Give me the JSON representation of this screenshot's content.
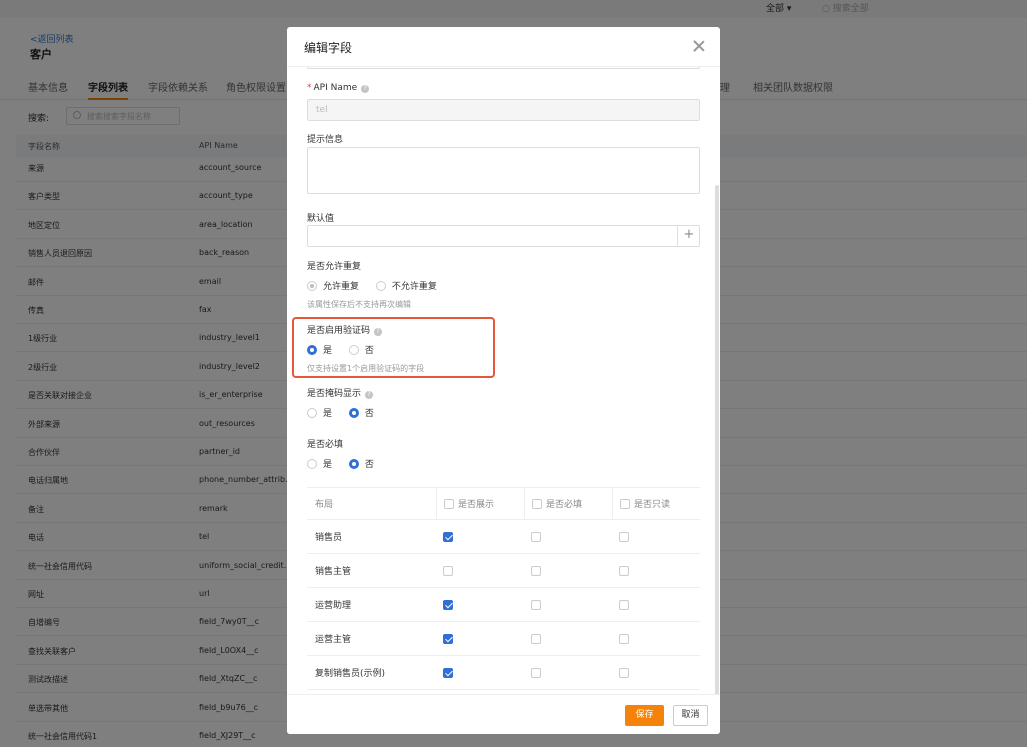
{
  "topbar": {
    "filter_label": "全部 ▾",
    "search_placeholder": "搜索全部"
  },
  "header": {
    "back_link": "<返回列表",
    "title": "客户"
  },
  "tabs": [
    {
      "label": "基本信息"
    },
    {
      "label": "字段列表",
      "active": true
    },
    {
      "label": "字段依赖关系"
    },
    {
      "label": "角色权限设置"
    },
    {
      "label": "理"
    },
    {
      "label": "相关团队数据权限"
    }
  ],
  "search": {
    "label": "搜索:",
    "placeholder": "搜索搜索字段名称"
  },
  "table": {
    "columns": [
      "字段名称",
      "API Name"
    ],
    "rows": [
      [
        "来源",
        "account_source"
      ],
      [
        "客户类型",
        "account_type"
      ],
      [
        "地区定位",
        "area_location"
      ],
      [
        "销售人员退回原因",
        "back_reason"
      ],
      [
        "邮件",
        "email"
      ],
      [
        "传真",
        "fax"
      ],
      [
        "1级行业",
        "industry_level1"
      ],
      [
        "2级行业",
        "industry_level2"
      ],
      [
        "是否关联对接企业",
        "is_er_enterprise"
      ],
      [
        "外部来源",
        "out_resources"
      ],
      [
        "合作伙伴",
        "partner_id"
      ],
      [
        "电话归属地",
        "phone_number_attrib..."
      ],
      [
        "备注",
        "remark"
      ],
      [
        "电话",
        "tel"
      ],
      [
        "统一社会信用代码",
        "uniform_social_credit..."
      ],
      [
        "网址",
        "url"
      ],
      [
        "自增编号",
        "field_7wy0T__c"
      ],
      [
        "查找关联客户",
        "field_L0OX4__c"
      ],
      [
        "测试改描述",
        "field_XtqZC__c"
      ],
      [
        "单选带其他",
        "field_b9u76__c"
      ],
      [
        "统一社会信用代码1",
        "field_XJ29T__c"
      ]
    ]
  },
  "modal": {
    "title": "编辑字段",
    "api_name": {
      "label": "API Name",
      "value": "tel"
    },
    "hint_info": {
      "label": "提示信息"
    },
    "default_value": {
      "label": "默认值",
      "plus": "+"
    },
    "allow_duplicate": {
      "label": "是否允许重复",
      "options": [
        "允许重复",
        "不允许重复"
      ],
      "note": "该属性保存后不支持再次编辑"
    },
    "verify_code": {
      "label": "是否启用验证码",
      "options": [
        "是",
        "否"
      ],
      "note": "仅支持设置1个启用验证码的字段"
    },
    "mask_display": {
      "label": "是否掩码显示",
      "options": [
        "是",
        "否"
      ]
    },
    "required": {
      "label": "是否必填",
      "options": [
        "是",
        "否"
      ]
    },
    "layout_table": {
      "headers": [
        "布局",
        "是否展示",
        "是否必填",
        "是否只读"
      ],
      "rows": [
        {
          "name": "销售员",
          "show": true,
          "required": false,
          "readonly": false
        },
        {
          "name": "销售主管",
          "show": false,
          "required": false,
          "readonly": false
        },
        {
          "name": "运营助理",
          "show": true,
          "required": false,
          "readonly": false
        },
        {
          "name": "运营主管",
          "show": true,
          "required": false,
          "readonly": false
        },
        {
          "name": "复制销售员(示例)",
          "show": true,
          "required": false,
          "readonly": false
        }
      ]
    },
    "buttons": {
      "save": "保存",
      "cancel": "取消"
    }
  },
  "colors": {
    "accent_orange": "#f5820a",
    "radio_blue": "#2f6fd6",
    "highlight_red": "#e8553a"
  }
}
